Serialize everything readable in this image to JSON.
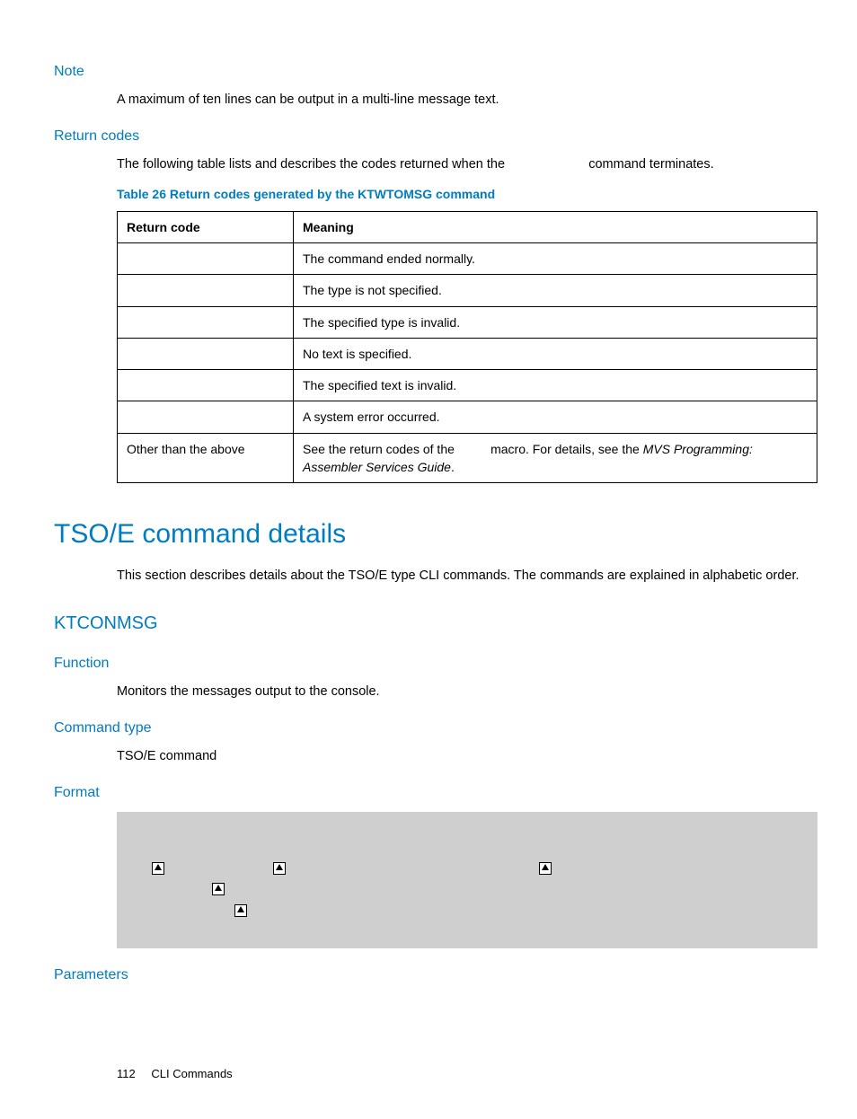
{
  "note": {
    "heading": "Note",
    "text": "A maximum of ten lines can be output in a multi-line message text."
  },
  "return_codes": {
    "heading": "Return codes",
    "intro_a": "The following table lists and describes the codes returned when the ",
    "intro_b": " command terminates.",
    "table_caption": "Table 26 Return codes generated by the KTWTOMSG command",
    "col0": "Return code",
    "col1": "Meaning",
    "rows": [
      {
        "code": "",
        "meaning": "The command ended normally."
      },
      {
        "code": "",
        "meaning": "The type is not specified."
      },
      {
        "code": "",
        "meaning": "The specified type is invalid."
      },
      {
        "code": "",
        "meaning": "No text is specified."
      },
      {
        "code": "",
        "meaning": "The specified text is invalid."
      },
      {
        "code": "",
        "meaning": "A system error occurred."
      }
    ],
    "last_row": {
      "code": "Other than the above",
      "meaning_a": "See the return codes of the ",
      "meaning_gap": "          ",
      "meaning_b": " macro. For details, see the ",
      "italic": "MVS Programming: Assembler Services Guide",
      "period": "."
    }
  },
  "tsoe": {
    "heading": "TSO/E command details",
    "intro": "This section describes details about the TSO/E type CLI commands. The commands are explained in alphabetic order."
  },
  "ktconmsg": {
    "heading": "KTCONMSG",
    "function_h": "Function",
    "function_t": "Monitors the messages output to the console.",
    "cmdtype_h": "Command type",
    "cmdtype_t": "TSO/E command",
    "format_h": "Format",
    "params_h": "Parameters"
  },
  "footer": {
    "page": "112",
    "section": "CLI Commands"
  }
}
